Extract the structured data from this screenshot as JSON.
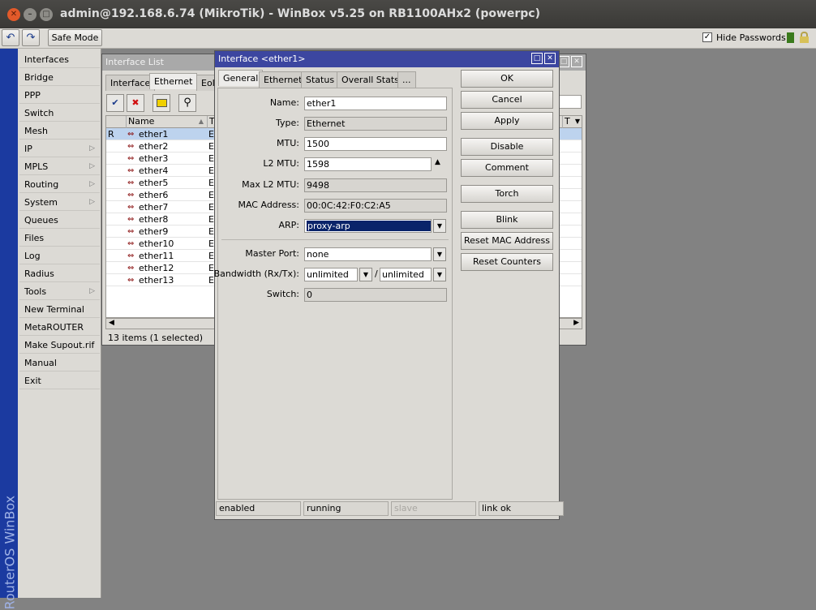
{
  "window": {
    "title": "admin@192.168.6.74 (MikroTik) - WinBox v5.25 on RB1100AHx2 (powerpc)"
  },
  "toolbar": {
    "safe_mode_label": "Safe Mode",
    "hide_passwords_label": "Hide Passwords",
    "hide_passwords_checked": true
  },
  "brand": "RouterOS WinBox",
  "menu": [
    {
      "label": "Interfaces",
      "sub": false
    },
    {
      "label": "Bridge",
      "sub": false
    },
    {
      "label": "PPP",
      "sub": false
    },
    {
      "label": "Switch",
      "sub": false
    },
    {
      "label": "Mesh",
      "sub": false
    },
    {
      "label": "IP",
      "sub": true
    },
    {
      "label": "MPLS",
      "sub": true
    },
    {
      "label": "Routing",
      "sub": true
    },
    {
      "label": "System",
      "sub": true
    },
    {
      "label": "Queues",
      "sub": false
    },
    {
      "label": "Files",
      "sub": false
    },
    {
      "label": "Log",
      "sub": false
    },
    {
      "label": "Radius",
      "sub": false
    },
    {
      "label": "Tools",
      "sub": true
    },
    {
      "label": "New Terminal",
      "sub": false
    },
    {
      "label": "MetaROUTER",
      "sub": false
    },
    {
      "label": "Make Supout.rif",
      "sub": false
    },
    {
      "label": "Manual",
      "sub": false
    },
    {
      "label": "Exit",
      "sub": false
    }
  ],
  "iface_list": {
    "title": "Interface List",
    "tabs": [
      "Interface",
      "Ethernet",
      "EoII"
    ],
    "active_tab": 1,
    "columns": [
      "Name",
      "T"
    ],
    "rows": [
      {
        "flag": "R",
        "name": "ether1",
        "type": "Et"
      },
      {
        "flag": "",
        "name": "ether2",
        "type": "Et"
      },
      {
        "flag": "",
        "name": "ether3",
        "type": "Et"
      },
      {
        "flag": "",
        "name": "ether4",
        "type": "Et"
      },
      {
        "flag": "",
        "name": "ether5",
        "type": "Et"
      },
      {
        "flag": "",
        "name": "ether6",
        "type": "Et"
      },
      {
        "flag": "",
        "name": "ether7",
        "type": "Et"
      },
      {
        "flag": "",
        "name": "ether8",
        "type": "Et"
      },
      {
        "flag": "",
        "name": "ether9",
        "type": "Et"
      },
      {
        "flag": "",
        "name": "ether10",
        "type": "Et"
      },
      {
        "flag": "",
        "name": "ether11",
        "type": "Et"
      },
      {
        "flag": "",
        "name": "ether12",
        "type": "Et"
      },
      {
        "flag": "",
        "name": "ether13",
        "type": "Et"
      }
    ],
    "status": "13 items (1 selected)",
    "right_col_header": "T"
  },
  "dialog": {
    "title": "Interface <ether1>",
    "tabs": [
      "General",
      "Ethernet",
      "Status",
      "Overall Stats",
      "..."
    ],
    "active_tab": 0,
    "fields": {
      "name": {
        "label": "Name:",
        "value": "ether1"
      },
      "type": {
        "label": "Type:",
        "value": "Ethernet"
      },
      "mtu": {
        "label": "MTU:",
        "value": "1500"
      },
      "l2mtu": {
        "label": "L2 MTU:",
        "value": "1598"
      },
      "max_l2mtu": {
        "label": "Max L2 MTU:",
        "value": "9498"
      },
      "mac": {
        "label": "MAC Address:",
        "value": "00:0C:42:F0:C2:A5"
      },
      "arp": {
        "label": "ARP:",
        "value": "proxy-arp"
      },
      "master_port": {
        "label": "Master Port:",
        "value": "none"
      },
      "bandwidth": {
        "label": "Bandwidth (Rx/Tx):",
        "rx": "unlimited",
        "sep": "/",
        "tx": "unlimited"
      },
      "switch": {
        "label": "Switch:",
        "value": "0"
      }
    },
    "buttons": [
      "OK",
      "Cancel",
      "Apply",
      "Disable",
      "Comment",
      "Torch",
      "Blink",
      "Reset MAC Address",
      "Reset Counters"
    ],
    "status": [
      "enabled",
      "running",
      "slave",
      "link ok"
    ]
  },
  "colors": {
    "title_active": "#3c46a0",
    "title_inactive": "#a8a8a8",
    "selection": "#0a246a",
    "brand_strip": "#1b3aa0"
  }
}
